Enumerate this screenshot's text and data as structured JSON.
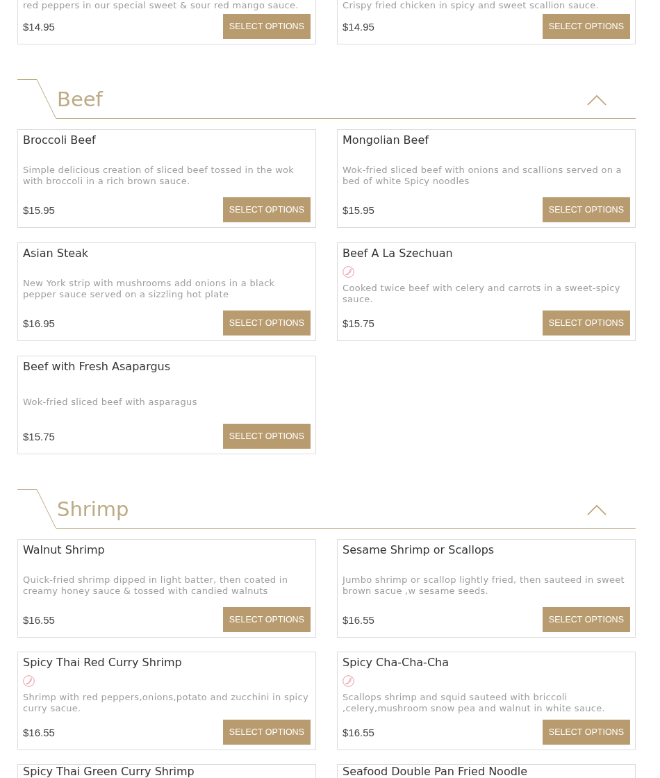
{
  "menu": [
    {
      "kind": "continued",
      "items": [
        {
          "kind": "lower",
          "description": "red peppers in our special sweet & sour red mango sauce.",
          "price": "$14.95",
          "button": "SELECT OPTIONS"
        },
        {
          "kind": "lower",
          "description": "Crispy fried chicken in spicy and sweet scallion sauce.",
          "price": "$14.95",
          "button": "SELECT OPTIONS"
        }
      ]
    },
    {
      "kind": "section",
      "title": "Beef",
      "expanded": true,
      "items": [
        {
          "kind": "full",
          "name": "Broccoli Beef",
          "spicy": false,
          "description": "Simple delicious creation of sliced beef tossed in the wok with broccoli in a rich brown sauce.",
          "price": "$15.95",
          "button": "SELECT OPTIONS"
        },
        {
          "kind": "full",
          "name": "Mongolian Beef",
          "spicy": false,
          "description": "Wok-fried sliced beef with onions and scallions served on a bed of white Spicy noodles",
          "price": "$15.95",
          "button": "SELECT OPTIONS"
        },
        {
          "kind": "full",
          "name": "Asian Steak",
          "spicy": false,
          "description": "New York strip with mushrooms add onions in a black pepper sauce served on a sizzling hot plate",
          "price": "$16.95",
          "button": "SELECT OPTIONS"
        },
        {
          "kind": "full",
          "name": "Beef A La Szechuan",
          "spicy": true,
          "description": "Cooked twice beef with celery and carrots in a sweet-spicy sauce.",
          "price": "$15.75",
          "button": "SELECT OPTIONS"
        },
        {
          "kind": "full",
          "name": "Beef with Fresh Asapargus",
          "spicy": false,
          "description": "Wok-fried sliced beef with asparagus",
          "price": "$15.75",
          "button": "SELECT OPTIONS"
        }
      ]
    },
    {
      "kind": "section",
      "title": "Shrimp",
      "expanded": true,
      "items": [
        {
          "kind": "full",
          "name": "Walnut Shrimp",
          "spicy": false,
          "description": "Quick-fried shrimp dipped in light batter, then coated in creamy honey sauce & tossed with candied walnuts",
          "price": "$16.55",
          "button": "SELECT OPTIONS"
        },
        {
          "kind": "full",
          "name": "Sesame Shrimp or Scallops",
          "spicy": false,
          "description": "Jumbo shrimp or scallop lightly fried, then sauteed in sweet brown sacue ,w sesame seeds.",
          "price": "$16.55",
          "button": "SELECT OPTIONS"
        },
        {
          "kind": "full",
          "name": "Spicy Thai Red Curry Shrimp",
          "spicy": true,
          "description": "Shrimp with red peppers,onions,potato and zucchini in spicy curry sacue.",
          "price": "$16.55",
          "button": "SELECT OPTIONS"
        },
        {
          "kind": "full",
          "name": "Spicy Cha-Cha-Cha",
          "spicy": true,
          "description": "Scallops shrimp and squid sauteed with briccoli ,celery,mushroom snow pea and walnut in white sauce.",
          "price": "$16.55",
          "button": "SELECT OPTIONS"
        },
        {
          "kind": "upper",
          "name": "Spicy Thai Green Curry Shrimp"
        },
        {
          "kind": "upper",
          "name": "Seafood Double Pan Fried Noodle"
        }
      ]
    }
  ]
}
